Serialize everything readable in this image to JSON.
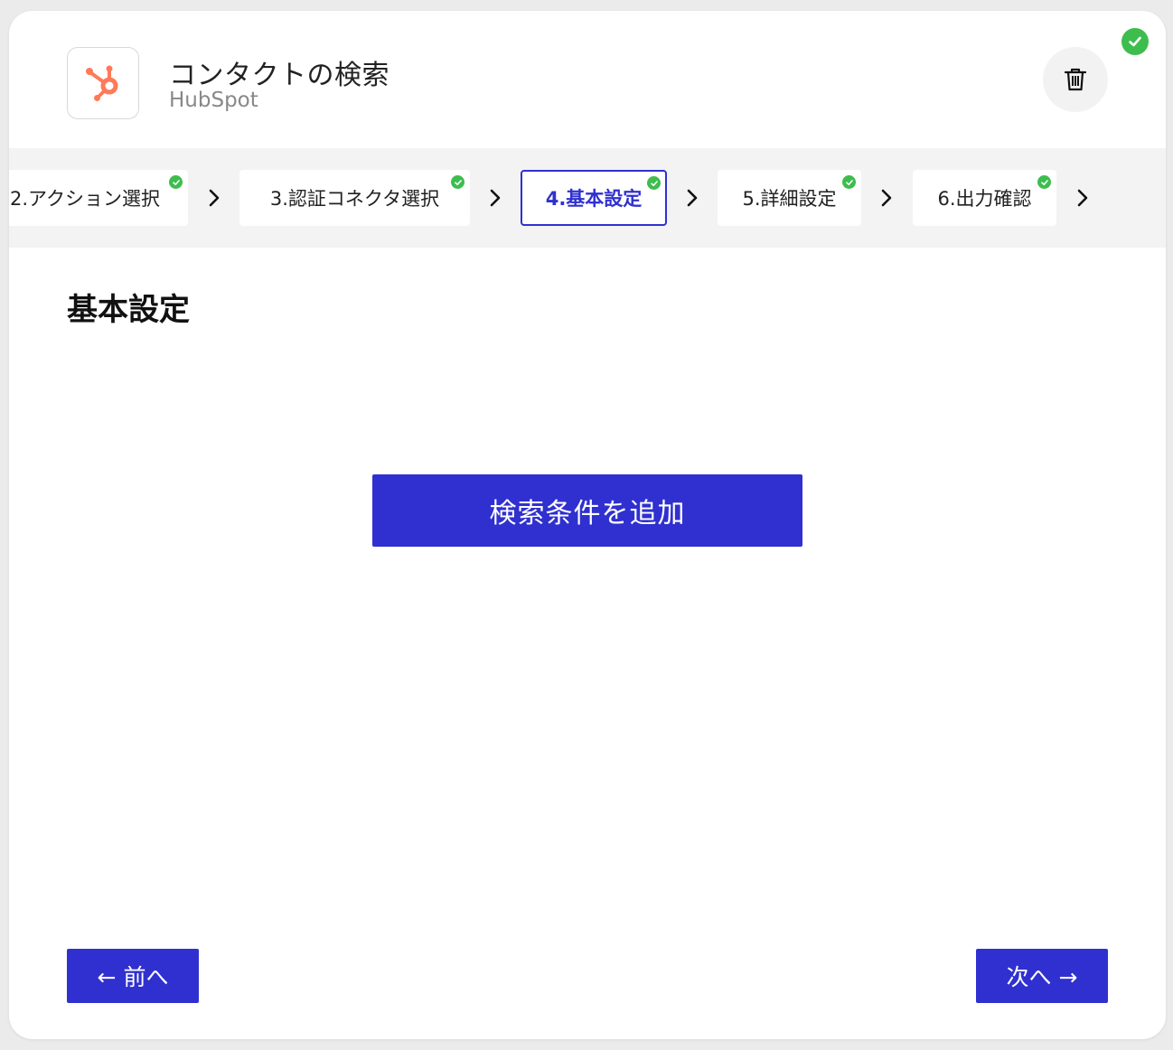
{
  "header": {
    "title": "コンタクトの検索",
    "subtitle": "HubSpot",
    "brand_color": "#ff7a59",
    "trash_icon": "trash-icon",
    "status_icon": "check-circle-icon",
    "status_color": "#3ebd4f"
  },
  "steps": [
    {
      "label": "2.アクション選択",
      "completed": true,
      "active": false
    },
    {
      "label": "3.認証コネクタ選択",
      "completed": true,
      "active": false
    },
    {
      "label": "4.基本設定",
      "completed": true,
      "active": true
    },
    {
      "label": "5.詳細設定",
      "completed": true,
      "active": false
    },
    {
      "label": "6.出力確認",
      "completed": true,
      "active": false
    }
  ],
  "main": {
    "section_title": "基本設定",
    "add_condition_label": "検索条件を追加"
  },
  "footer": {
    "prev_label": "← 前へ",
    "next_label": "次へ →"
  },
  "colors": {
    "accent": "#3030d0",
    "success": "#3ebd4f"
  }
}
